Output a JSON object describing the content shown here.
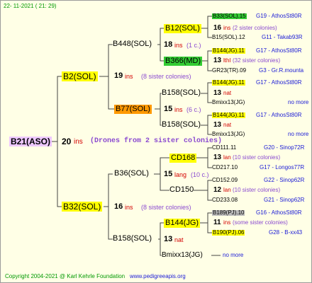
{
  "header": {
    "timestamp": "22- 11-2021 ( 21: 29)"
  },
  "footer": {
    "copyright": "Copyright 2004-2021 @ Karl Kehrle Foundation",
    "site": "www.pedigreeapis.org"
  },
  "root": {
    "name": "B21(ASO)",
    "ins": "20",
    "ins_label": "ins",
    "note": "(Drones from 2 sister colonies)"
  },
  "gen1": {
    "mother": {
      "name": "B2(SOL)",
      "ins": "19",
      "ins_label": "ins",
      "note": "(8 sister colonies)"
    },
    "father": {
      "name": "B32(SOL)",
      "ins": "16",
      "ins_label": "ins",
      "note": "(8 sister colonies)"
    }
  },
  "gen2": {
    "b448": {
      "name": "B448(SOL)",
      "ins": "18",
      "ins_label": "ins",
      "note": "(1 c.)"
    },
    "b77": {
      "name": "B77(SOL)",
      "ins": "15",
      "ins_label": "ins",
      "note": "(6 c.)"
    },
    "b36": {
      "name": "B36(SOL)",
      "ins": "15",
      "ins_label": "lang",
      "note": "(10 c.)"
    },
    "b158": {
      "name": "B158(SOL)",
      "ins": "13",
      "ins_label": "nat"
    }
  },
  "gen3": {
    "b12": {
      "name": "B12(SOL)",
      "ins": "16",
      "ins_label": "ins",
      "note": "(2 sister colonies)"
    },
    "b366": {
      "name": "B366(MD)",
      "ins": "13",
      "ins_label": "lthl",
      "note": "(32 sister colonies)"
    },
    "b158a": {
      "name": "B158(SOL)",
      "ins": "13",
      "ins_label": "nat"
    },
    "b158b": {
      "name": "B158(SOL)",
      "ins": "13",
      "ins_label": "nat"
    },
    "cd168": {
      "name": "CD168",
      "ins": "13",
      "ins_label": "lan",
      "note": "(10 sister colonies)"
    },
    "cd150": {
      "name": "CD150",
      "ins": "12",
      "ins_label": "lan",
      "note": "(10 sister colonies)"
    },
    "b144": {
      "name": "B144(JG)",
      "ins": "11",
      "ins_label": "ins",
      "note": "(some sister colonies)"
    },
    "bmixx13": {
      "name": "Bmixx13(JG)",
      "right": "no more"
    }
  },
  "gen4": [
    {
      "name": "B33(SOL).15",
      "right": "G19 - AthosSt80R"
    },
    {
      "name": "B15(SOL).12",
      "right": "G11 - Takab93R"
    },
    {
      "name": "B144(JG).11",
      "right": "G17 - AthosSt80R"
    },
    {
      "name": "GR23(TR).09",
      "right": "G3 - Gr.R.mounta"
    },
    {
      "name": "B144(JG).11",
      "right": "G17 - AthosSt80R"
    },
    {
      "name": "Bmixx13(JG)",
      "right": "no more"
    },
    {
      "name": "B144(JG).11",
      "right": "G17 - AthosSt80R"
    },
    {
      "name": "Bmixx13(JG)",
      "right": "no more"
    },
    {
      "name": "CD111.11",
      "right": "G20 - Sinop72R"
    },
    {
      "name": "CD217.10",
      "right": "G17 - Longos77R"
    },
    {
      "name": "CD152.09",
      "right": "G22 - Sinop62R"
    },
    {
      "name": "CD233.08",
      "right": "G21 - Sinop62R"
    },
    {
      "name": "B189(PJ).10",
      "right": "G16 - AthosSt80R"
    },
    {
      "name": "B190(PJ).06",
      "right": "G28 - B-xx43"
    }
  ]
}
